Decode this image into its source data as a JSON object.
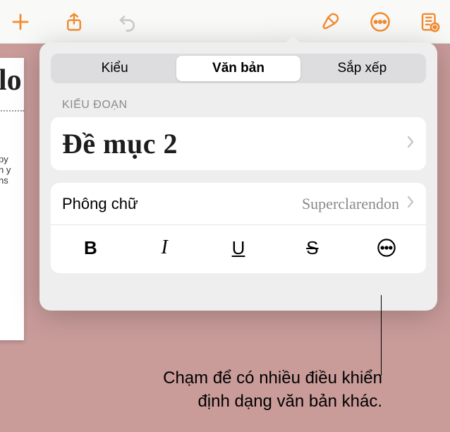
{
  "toolbar": {
    "add": "add-icon",
    "share": "share-icon",
    "undo": "undo-icon",
    "format": "format-brush-icon",
    "more": "more-icon",
    "presenter": "presenter-icon"
  },
  "doc_fragment": {
    "title_glimpse": "lo",
    "body_lines": [
      "py",
      "n y",
      "ns"
    ]
  },
  "popover": {
    "tabs": [
      "Kiểu",
      "Văn bản",
      "Sắp xếp"
    ],
    "active_tab_index": 1,
    "section_label": "KIỂU ĐOẠN",
    "paragraph_style": "Đề mục 2",
    "font_label": "Phông chữ",
    "font_value": "Superclarendon",
    "style_buttons": {
      "bold": "B",
      "italic": "I",
      "underline": "U",
      "strike": "S",
      "more": "more-options"
    }
  },
  "callout": {
    "line1": "Chạm để có nhiều điều khiển",
    "line2": "định dạng văn bản khác."
  }
}
